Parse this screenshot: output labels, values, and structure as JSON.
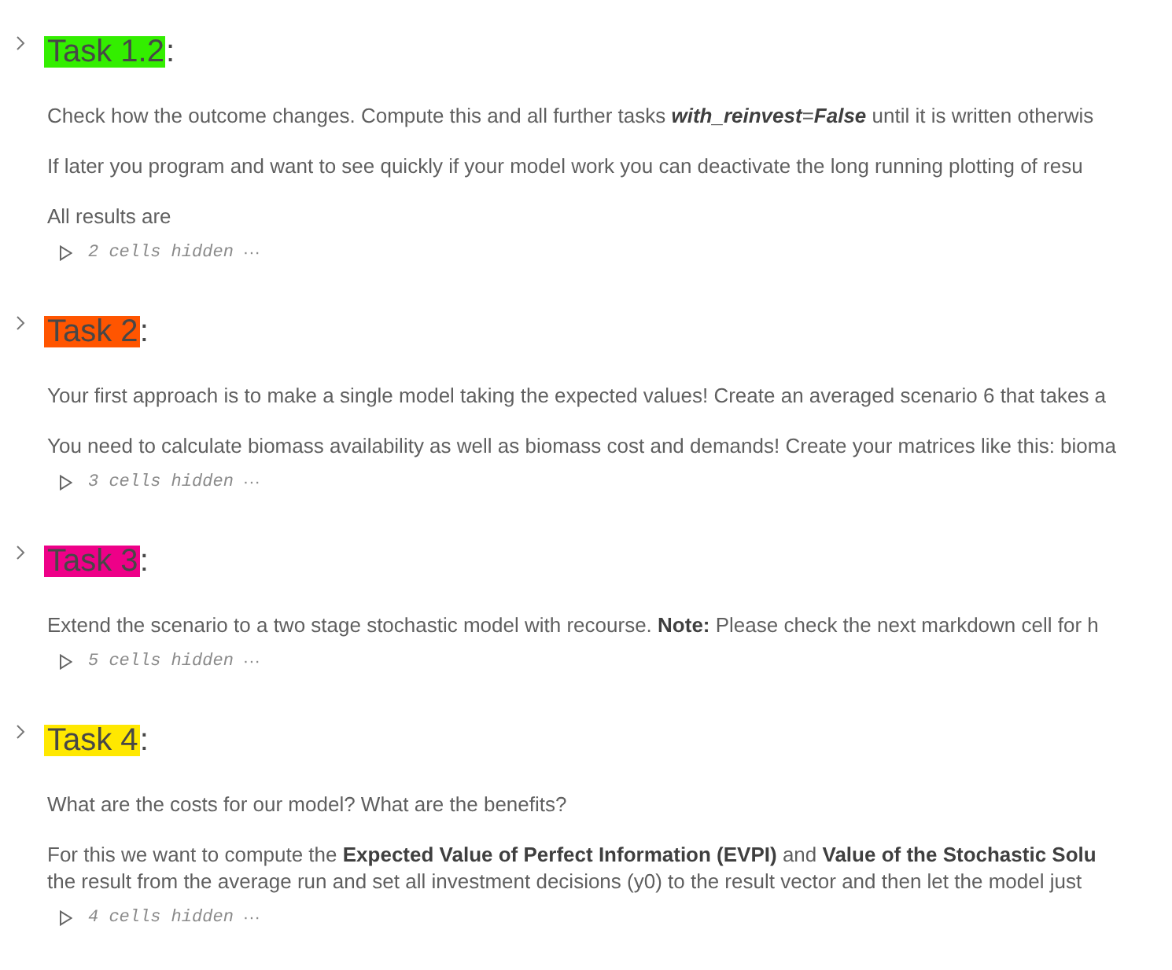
{
  "sections": [
    {
      "title": "Task 1.2",
      "title_suffix": ":",
      "color": "#33ee00",
      "paragraphs": [
        {
          "lines": [
            "Check how the outcome changes. Compute this and all further tasks *with_reinvest*=*False* until it is written otherwis"
          ]
        },
        {
          "lines": [
            "If later you program and want to see quickly if your model work you can deactivate the long running plotting of resu"
          ]
        },
        {
          "lines": [
            "All results are"
          ]
        }
      ],
      "hidden_cells": {
        "label": "2 cells hidden",
        "more": "···"
      }
    },
    {
      "title": "Task 2",
      "title_suffix": ":",
      "color": "#ff5500",
      "paragraphs": [
        {
          "lines": [
            "Your first approach is to make a single model taking the expected values! Create an averaged scenario 6 that takes a"
          ]
        },
        {
          "lines": [
            "You need to calculate biomass availability as well as biomass cost and demands! Create your matrices like this: bioma"
          ]
        }
      ],
      "hidden_cells": {
        "label": "3 cells hidden",
        "more": "···"
      }
    },
    {
      "title": "Task 3",
      "title_suffix": ":",
      "color": "#ee0088",
      "paragraphs": [
        {
          "lines": [
            "Extend the scenario to a two stage stochastic model with recourse. **Note:** Please check the next markdown cell for h"
          ]
        }
      ],
      "hidden_cells": {
        "label": "5 cells hidden",
        "more": "···"
      }
    },
    {
      "title": "Task 4",
      "title_suffix": ":",
      "color": "#ffe800",
      "paragraphs": [
        {
          "lines": [
            "What are the costs for our model? What are the benefits?"
          ]
        },
        {
          "lines": [
            "For this we want to compute the **Expected Value of Perfect Information (EVPI)** and **Value of the Stochastic Solu**",
            "the result from the average run and set all investment decisions (y0) to the result vector and then let the model just"
          ]
        }
      ],
      "hidden_cells": {
        "label": "4 cells hidden",
        "more": "···"
      }
    }
  ]
}
